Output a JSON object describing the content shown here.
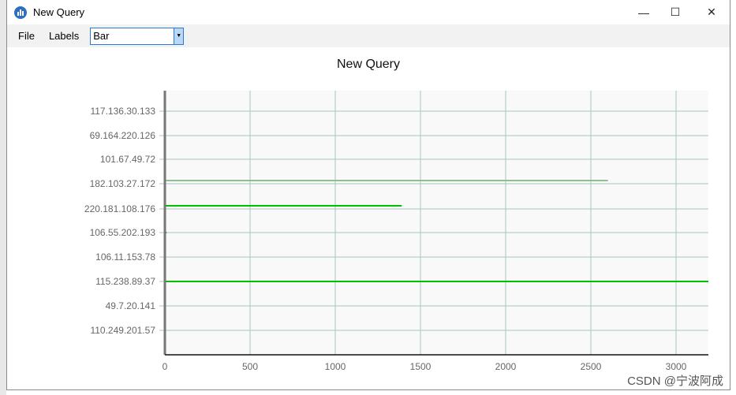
{
  "window": {
    "title": "New Query",
    "minimize": "—",
    "maximize": "☐",
    "close": "✕",
    "icon": "bar-chart-icon"
  },
  "menu": {
    "file": "File",
    "labels": "Labels",
    "chart_type": "Bar"
  },
  "watermark": "CSDN @宁波阿成",
  "chart_data": {
    "type": "bar",
    "orientation": "horizontal",
    "title": "New Query",
    "categories": [
      "117.136.30.133",
      "69.164.220.126",
      "101.67.49.72",
      "182.103.27.172",
      "220.181.108.176",
      "106.55.202.193",
      "106.11.153.78",
      "115.238.89.37",
      "49.7.20.141",
      "110.249.201.57"
    ],
    "values": [
      5,
      3,
      3,
      2600,
      1390,
      10,
      3,
      3200,
      3,
      5
    ],
    "xlim": [
      0,
      3200
    ],
    "xticks": [
      0,
      500,
      1000,
      1500,
      2000,
      2500,
      3000
    ],
    "grid": true,
    "colors": {
      "bar": "#00c000",
      "grid": "#a9c4c4"
    }
  }
}
